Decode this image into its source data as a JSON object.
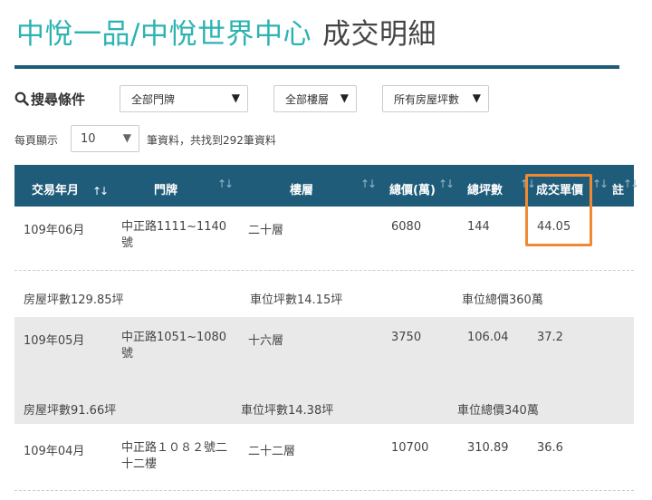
{
  "header": {
    "building_name": "中悅一品/中悅世界中心",
    "section_title": "成交明細"
  },
  "search": {
    "label": "搜尋條件",
    "icon": "search-icon",
    "selects": [
      {
        "name": "door-plate-select",
        "value": "全部門牌"
      },
      {
        "name": "floor-select",
        "value": "全部樓層"
      },
      {
        "name": "house-area-select",
        "value": "所有房屋坪數"
      }
    ]
  },
  "pagination": {
    "per_page_label": "每頁顯示",
    "per_page_value": "10",
    "result_count_text": "筆資料，共找到292筆資料"
  },
  "table": {
    "headers": [
      "交易年月",
      "門牌",
      "樓層",
      "總價(萬)",
      "總坪數",
      "成交單價",
      "註"
    ],
    "rows": [
      {
        "date": "109年06月",
        "address": "中正路1111~1140號",
        "floor": "二十層",
        "total_price": "6080",
        "total_area": "144",
        "unit_price": "44.05",
        "house_area": "房屋坪數129.85坪",
        "parking_area": "車位坪數14.15坪",
        "parking_price": "車位總價360萬"
      },
      {
        "date": "109年05月",
        "address": "中正路1051~1080號",
        "floor": "十六層",
        "total_price": "3750",
        "total_area": "106.04",
        "unit_price": "37.2",
        "house_area": "房屋坪數91.66坪",
        "parking_area": "車位坪數14.38坪",
        "parking_price": "車位總價340萬"
      },
      {
        "date": "109年04月",
        "address": "中正路１０８２號二十二樓",
        "floor": "二十二層",
        "total_price": "10700",
        "total_area": "310.89",
        "unit_price": "36.6"
      }
    ]
  },
  "colors": {
    "accent_teal": "#2bb3b1",
    "header_navy": "#1f5c7a",
    "highlight_orange": "#f08a30",
    "alt_row_gray": "#e9e9e9"
  }
}
